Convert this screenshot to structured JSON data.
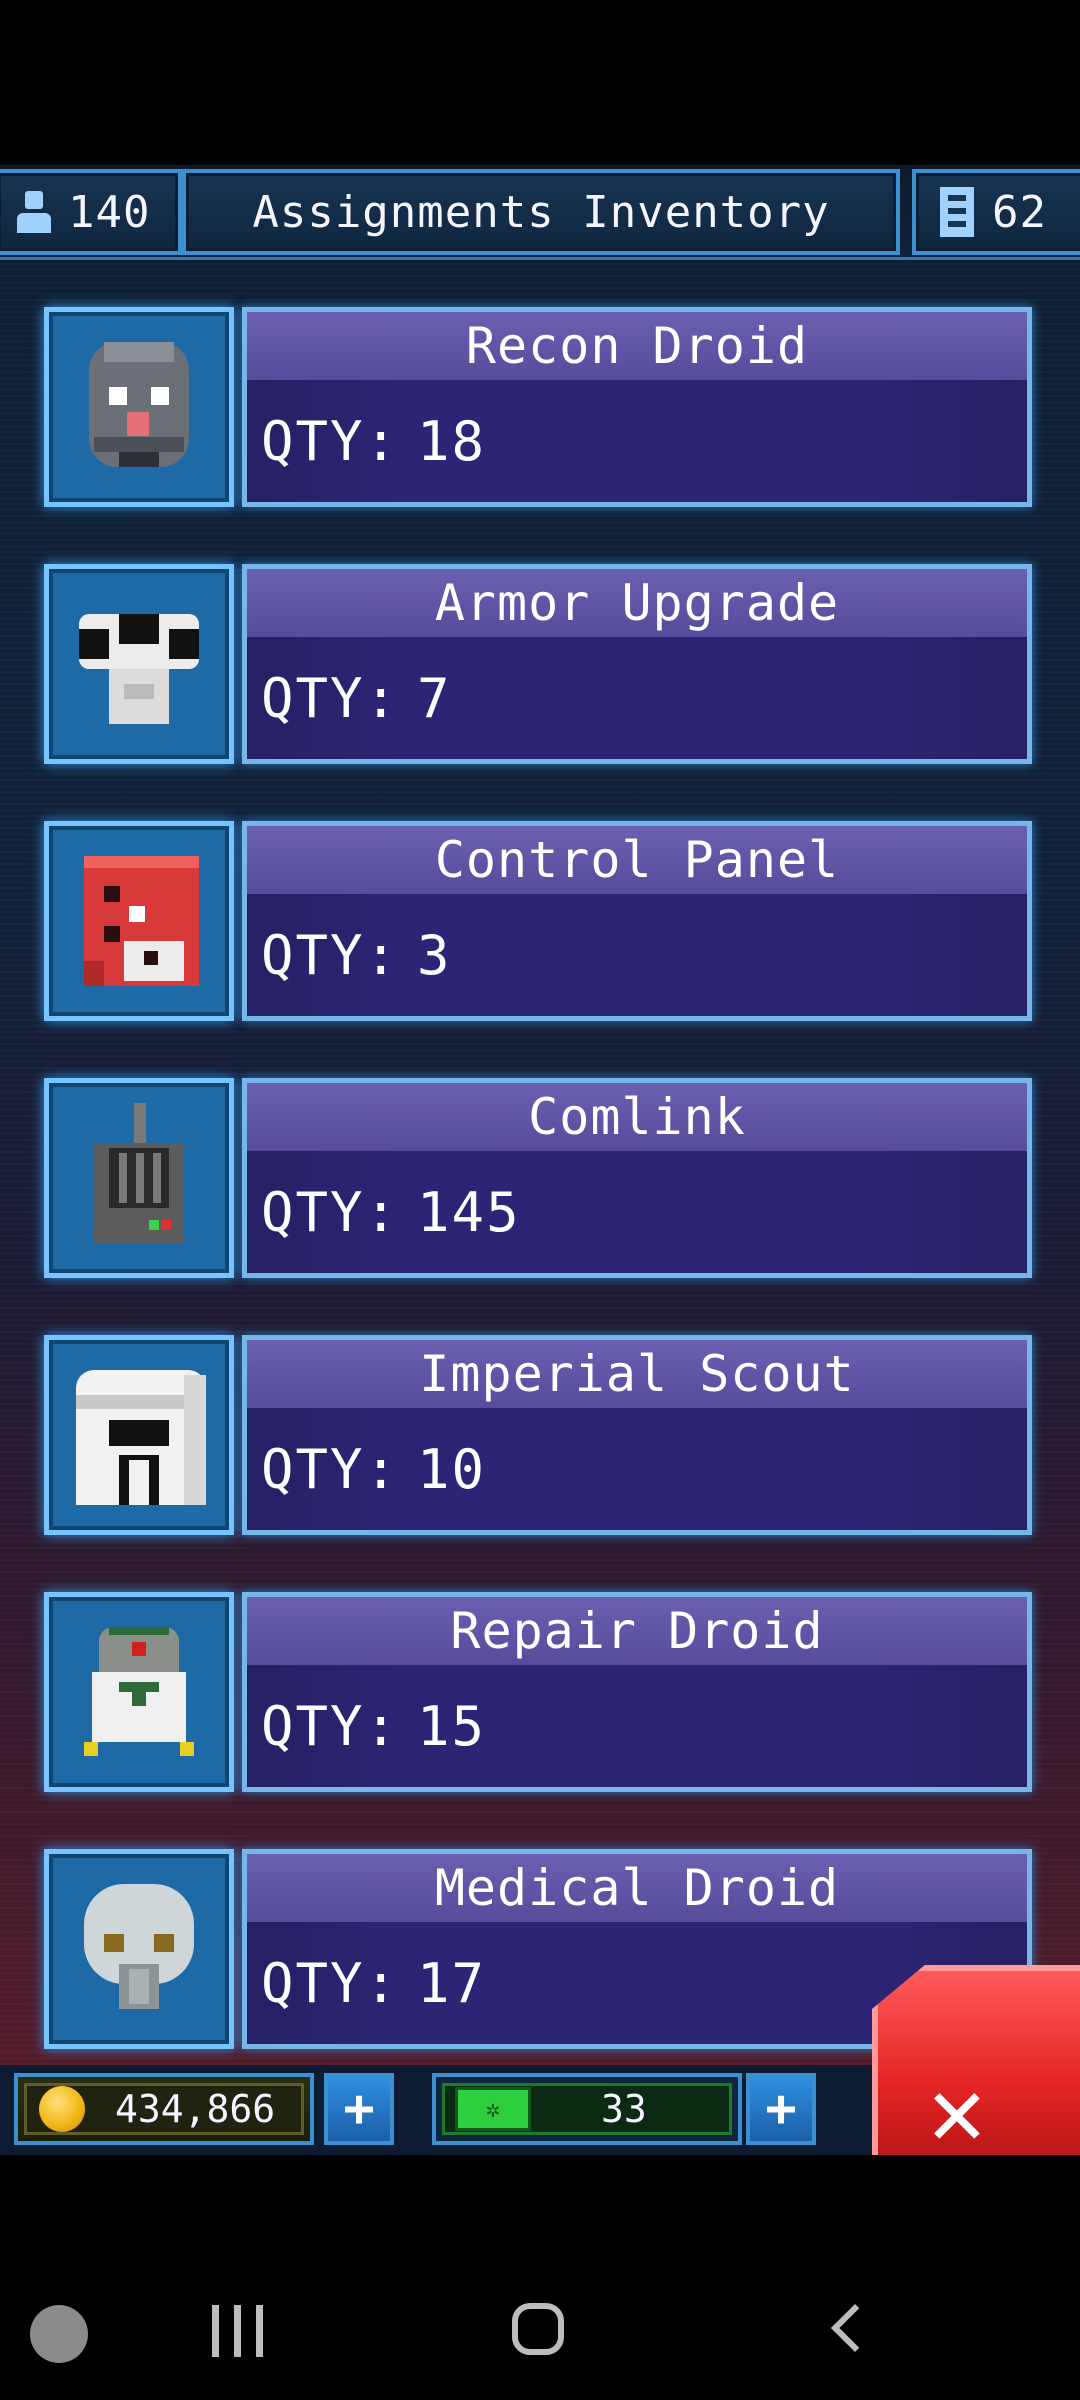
{
  "hud": {
    "population": "140",
    "title": "Assignments Inventory",
    "floors": "62"
  },
  "items": [
    {
      "name": "Recon Droid",
      "qty_label": "QTY:",
      "qty": "18",
      "icon": "recon-droid-icon"
    },
    {
      "name": "Armor Upgrade",
      "qty_label": "QTY:",
      "qty": "7",
      "icon": "armor-upgrade-icon"
    },
    {
      "name": "Control Panel",
      "qty_label": "QTY:",
      "qty": "3",
      "icon": "control-panel-icon"
    },
    {
      "name": "Comlink",
      "qty_label": "QTY:",
      "qty": "145",
      "icon": "comlink-icon"
    },
    {
      "name": "Imperial Scout",
      "qty_label": "QTY:",
      "qty": "10",
      "icon": "imperial-scout-icon"
    },
    {
      "name": "Repair Droid",
      "qty_label": "QTY:",
      "qty": "15",
      "icon": "repair-droid-icon"
    },
    {
      "name": "Medical Droid",
      "qty_label": "QTY:",
      "qty": "17",
      "icon": "medical-droid-icon"
    }
  ],
  "resources": {
    "coins": "434,866",
    "bux": "33",
    "plus_label": "+"
  },
  "close_label": "✕"
}
